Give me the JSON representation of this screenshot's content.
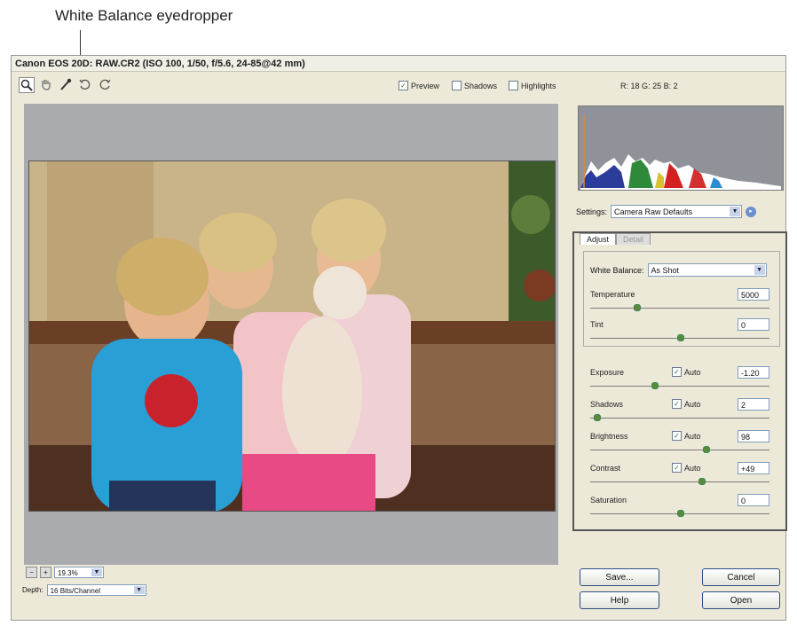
{
  "callout": {
    "label": "White Balance eyedropper"
  },
  "window": {
    "title": "Canon EOS 20D: RAW.CR2 (ISO 100, 1/50, f/5.6, 24-85@42 mm)"
  },
  "toolbar": {
    "tools": [
      {
        "name": "zoom-tool-icon",
        "glyph": "🔍"
      },
      {
        "name": "hand-tool-icon",
        "glyph": "✋"
      },
      {
        "name": "eyedropper-tool-icon",
        "glyph": "🖉"
      },
      {
        "name": "rotate-left-icon",
        "glyph": "↺"
      },
      {
        "name": "rotate-right-icon",
        "glyph": "↻"
      }
    ],
    "preview_label": "Preview",
    "shadows_label": "Shadows",
    "highlights_label": "Highlights",
    "preview_checked": true,
    "shadows_checked": false,
    "highlights_checked": false
  },
  "readout": {
    "r_label": "R:",
    "r": "18",
    "g_label": "G:",
    "g": "25",
    "b_label": "B:",
    "b": "2"
  },
  "settings": {
    "label": "Settings:",
    "value": "Camera Raw Defaults"
  },
  "tabs": [
    "Adjust",
    "Detail"
  ],
  "white_balance": {
    "label": "White Balance:",
    "value": "As Shot"
  },
  "adjust_sliders": [
    {
      "label": "Temperature",
      "value": "5000",
      "fraction": 0.25
    },
    {
      "label": "Tint",
      "value": "0",
      "fraction": 0.5
    }
  ],
  "tone_sliders": [
    {
      "label": "Exposure",
      "auto_label": "Auto",
      "auto": true,
      "value": "-1.20",
      "fraction": 0.35
    },
    {
      "label": "Shadows",
      "auto_label": "Auto",
      "auto": true,
      "value": "2",
      "fraction": 0.02
    },
    {
      "label": "Brightness",
      "auto_label": "Auto",
      "auto": true,
      "value": "98",
      "fraction": 0.65
    },
    {
      "label": "Contrast",
      "auto_label": "Auto",
      "auto": true,
      "value": "+49",
      "fraction": 0.62
    },
    {
      "label": "Saturation",
      "value": "0",
      "fraction": 0.5
    }
  ],
  "zoom": {
    "value": "19.3%"
  },
  "depth": {
    "label": "Depth:",
    "value": "16 Bits/Channel"
  },
  "buttons": {
    "save": "Save...",
    "cancel": "Cancel",
    "help": "Help",
    "open": "Open"
  },
  "colors": {
    "preview_bg": "#a9abaf",
    "histogram_bg": "#8f9298",
    "accent": "#2b4d82"
  }
}
